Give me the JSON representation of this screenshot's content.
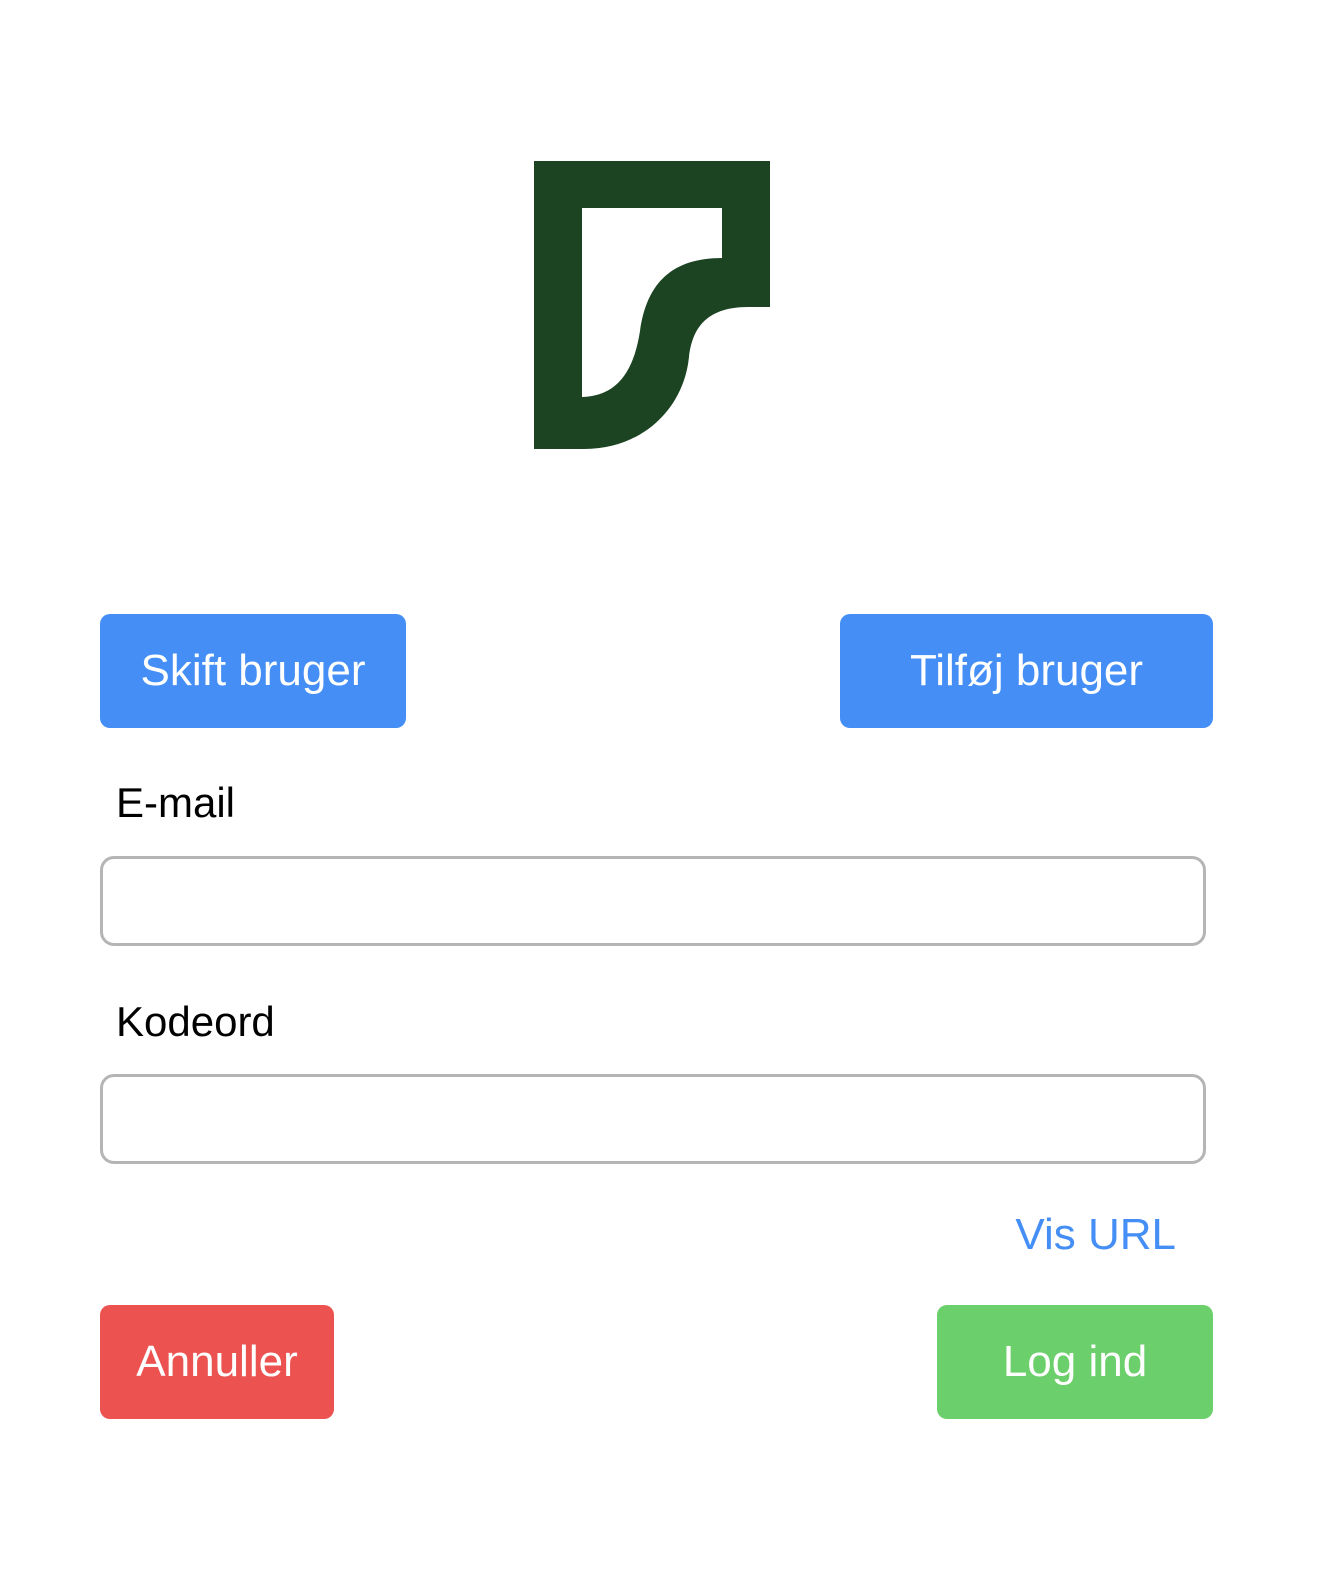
{
  "logo": {
    "icon": "brand-logo-icon",
    "color": "#1c4422"
  },
  "top_actions": {
    "switch_user": "Skift bruger",
    "add_user": "Tilføj bruger"
  },
  "form": {
    "email_label": "E-mail",
    "email_value": "",
    "password_label": "Kodeord",
    "password_value": ""
  },
  "show_url_link": "Vis URL",
  "bottom_actions": {
    "cancel": "Annuller",
    "login": "Log ind"
  },
  "colors": {
    "primary": "#448ef6",
    "danger": "#eb5250",
    "success": "#6bcf6b",
    "input_border": "#b5b5b5"
  }
}
